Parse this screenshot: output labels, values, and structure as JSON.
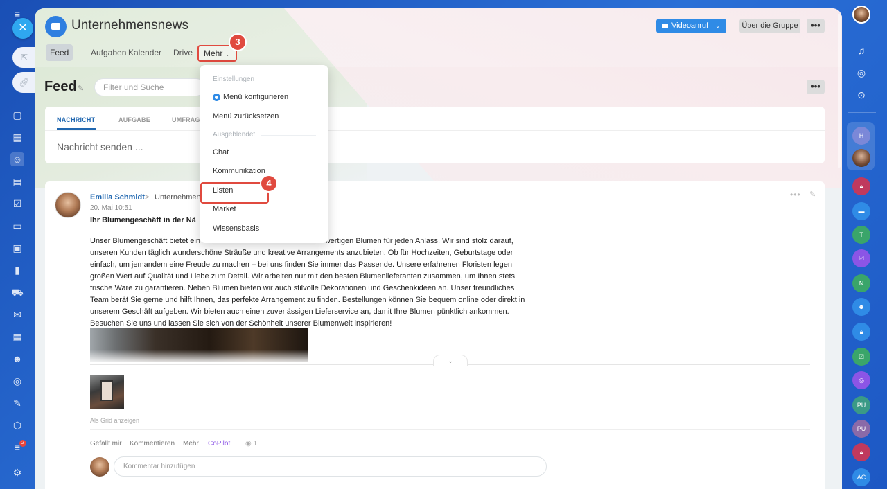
{
  "header": {
    "group_title": "Unternehmensnews",
    "video_button": "Videoanruf",
    "about_button": "Über die Gruppe",
    "more_button": "•••"
  },
  "tabs": [
    {
      "label": "Feed",
      "active": true
    },
    {
      "label": "Aufgaben"
    },
    {
      "label": "Kalender"
    },
    {
      "label": "Drive"
    },
    {
      "label": "Mehr"
    }
  ],
  "step_badges": [
    "3",
    "4"
  ],
  "feed": {
    "title": "Feed",
    "filter_placeholder": "Filter und Suche",
    "more_button": "•••"
  },
  "compose": {
    "tabs": [
      "NACHRICHT",
      "AUFGABE",
      "UMFRAG"
    ],
    "placeholder": "Nachricht senden ..."
  },
  "dropdown": {
    "section_settings": "Einstellungen",
    "configure": "Menü konfigurieren",
    "reset": "Menü zurücksetzen",
    "section_hidden": "Ausgeblendet",
    "items": [
      "Chat",
      "Kommunikation",
      "Listen",
      "Market",
      "Wissensbasis"
    ]
  },
  "post": {
    "author": "Emilia Schmidt",
    "arrow": ">",
    "group": "Unternehmen",
    "date": "20. Mai 10:51",
    "headline": "Ihr Blumengeschäft in der Nä",
    "body_lines": [
      "Unser Blumengeschäft bietet ein                                                   hochwertigen Blumen für jeden Anlass. Wir sind stolz darauf,",
      "unseren Kunden täglich wunderschöne Sträuße und kreative Arrangements anzubieten. Ob für Hochzeiten, Geburtstage oder",
      "einfach, um jemandem eine Freude zu machen – bei uns finden Sie immer das Passende. Unsere erfahrenen Floristen legen",
      "großen Wert auf Qualität und Liebe zum Detail. Wir arbeiten nur mit den besten Blumenlieferanten zusammen, um Ihnen stets",
      "frische Ware zu garantieren. Neben Blumen bieten wir auch stilvolle Dekorationen und Geschenkideen an. Unser freundliches",
      "Team berät Sie gerne und hilft Ihnen, das perfekte Arrangement zu finden. Bestellungen können Sie bequem online oder direkt in",
      "unserem Geschäft aufgeben. Wir bieten auch einen zuverlässigen Lieferservice an, damit Ihre Blumen pünktlich ankommen.",
      "Besuchen Sie uns und lassen Sie sich von der Schönheit unserer Blumenwelt inspirieren!"
    ],
    "grid_link": "Als Grid anzeigen",
    "actions": {
      "like": "Gefällt mir",
      "comment": "Kommentieren",
      "more": "Mehr",
      "copilot": "CoPilot"
    },
    "views": "1",
    "comment_placeholder": "Kommentar hinzufügen"
  },
  "right_sidebar": {
    "avatars": [
      "H",
      "T",
      "N",
      "PU",
      "PU",
      "AC"
    ]
  },
  "left_sidebar": {
    "notification_count": "2"
  },
  "colors": {
    "accent_blue": "#2f8be6",
    "highlight_red": "#e04a3f",
    "link_blue": "#2067b0",
    "copilot_purple": "#8b55e6"
  }
}
